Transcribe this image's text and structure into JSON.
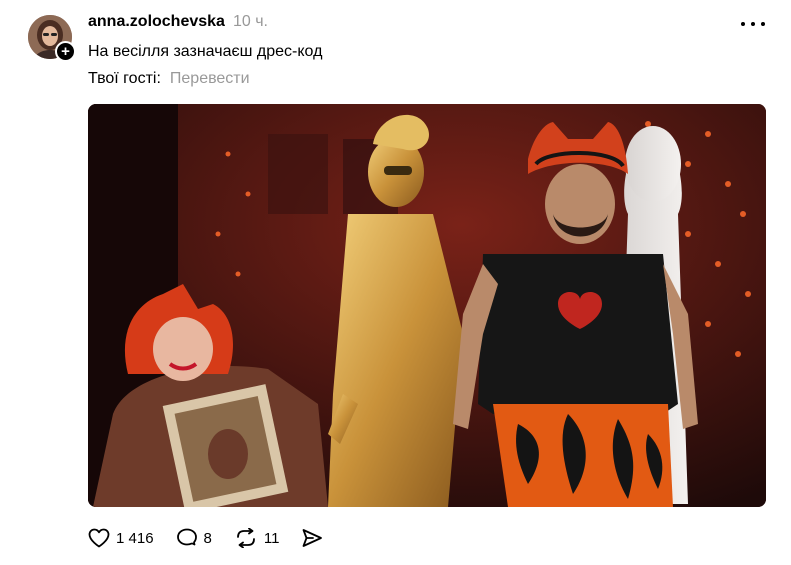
{
  "post": {
    "author": {
      "username": "anna.zolochevska",
      "avatar_icon": "user-avatar",
      "follow_badge": "+"
    },
    "timestamp": "10 ч.",
    "text": {
      "line1": "На весілля зазначаєш дрес-код",
      "line2": "Твої гості:"
    },
    "translate_label": "Перевести",
    "media": {
      "type": "photo"
    },
    "actions": {
      "likes": "1 416",
      "replies": "8",
      "reposts": "11",
      "like_icon": "heart-icon",
      "reply_icon": "comment-icon",
      "repost_icon": "repost-icon",
      "share_icon": "send-icon"
    }
  }
}
